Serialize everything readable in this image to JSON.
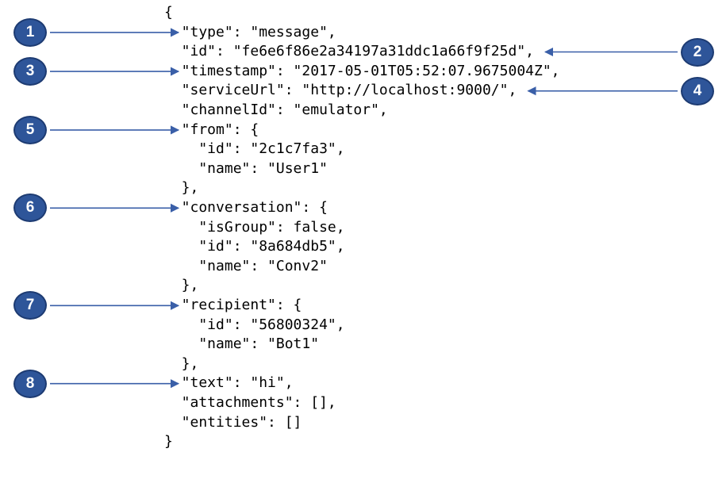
{
  "json_lines": [
    "{",
    "  \"type\": \"message\",",
    "  \"id\": \"fe6e6f86e2a34197a31ddc1a66f9f25d\",",
    "  \"timestamp\": \"2017-05-01T05:52:07.9675004Z\",",
    "  \"serviceUrl\": \"http://localhost:9000/\",",
    "  \"channelId\": \"emulator\",",
    "  \"from\": {",
    "    \"id\": \"2c1c7fa3\",",
    "    \"name\": \"User1\"",
    "  },",
    "  \"conversation\": {",
    "    \"isGroup\": false,",
    "    \"id\": \"8a684db5\",",
    "    \"name\": \"Conv2\"",
    "  },",
    "  \"recipient\": {",
    "    \"id\": \"56800324\",",
    "    \"name\": \"Bot1\"",
    "  },",
    "  \"text\": \"hi\",",
    "  \"attachments\": [],",
    "  \"entities\": []",
    "}"
  ],
  "callouts": [
    {
      "label": "1",
      "side": "left",
      "line": 1
    },
    {
      "label": "2",
      "side": "right",
      "line": 2
    },
    {
      "label": "3",
      "side": "left",
      "line": 3
    },
    {
      "label": "4",
      "side": "right",
      "line": 4
    },
    {
      "label": "5",
      "side": "left",
      "line": 6
    },
    {
      "label": "6",
      "side": "left",
      "line": 10
    },
    {
      "label": "7",
      "side": "left",
      "line": 15
    },
    {
      "label": "8",
      "side": "left",
      "line": 19
    }
  ],
  "colors": {
    "badge_fill": "#2e5599",
    "arrow": "#3a5fa8",
    "text": "#000000"
  }
}
